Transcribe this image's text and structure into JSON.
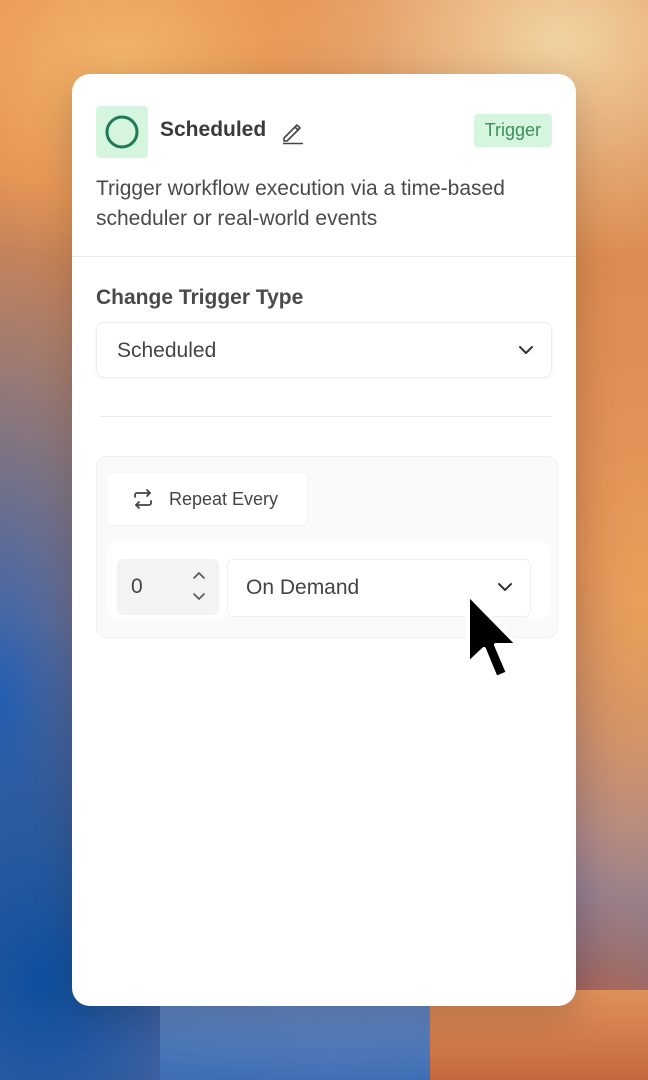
{
  "node": {
    "title": "Scheduled",
    "badge": "Trigger",
    "description": "Trigger workflow execution via a time-based scheduler or real-world events",
    "icon": "circle-icon",
    "accent_color": "#1f7a5a",
    "badge_bg": "#d6f5de",
    "badge_fg": "#3e8f5a"
  },
  "trigger_type": {
    "label": "Change Trigger Type",
    "selected": "Scheduled"
  },
  "repeat": {
    "label": "Repeat Every",
    "interval_value": "0",
    "unit_selected": "On Demand"
  }
}
